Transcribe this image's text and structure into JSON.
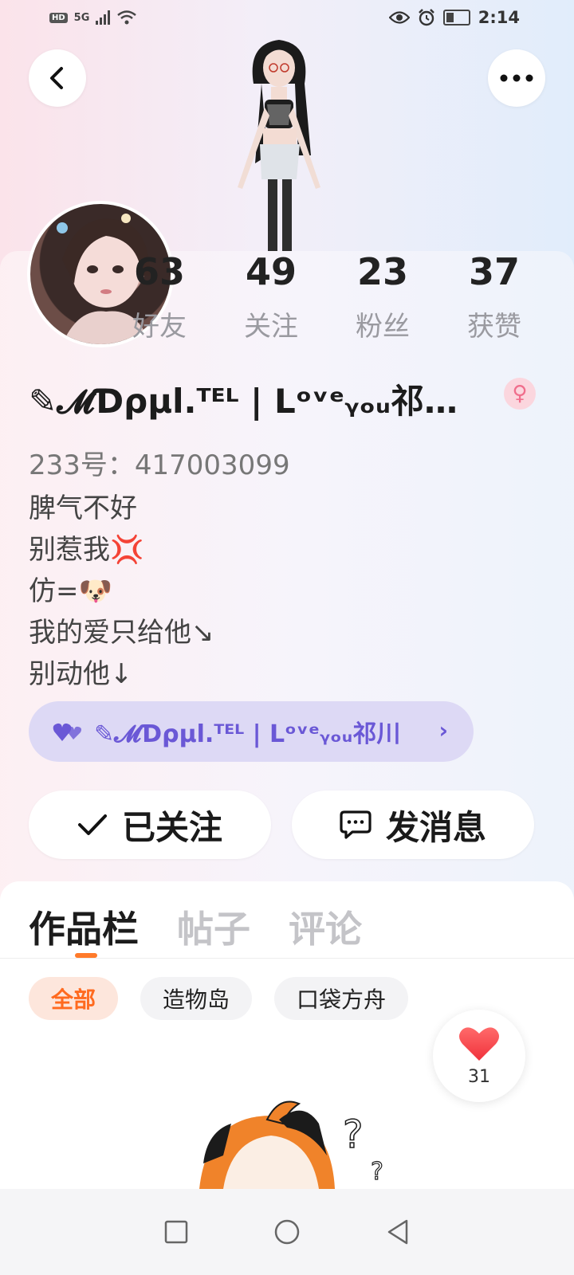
{
  "status_bar": {
    "hd": "HD",
    "network": "5G",
    "time": "2:14"
  },
  "profile": {
    "stats": [
      {
        "value": "63",
        "label": "好友"
      },
      {
        "value": "49",
        "label": "关注"
      },
      {
        "value": "23",
        "label": "粉丝"
      },
      {
        "value": "37",
        "label": "获赞"
      }
    ],
    "nickname": "✎𝓜Ɗρµl.ᵀᴱᴸ | Lᵒᵛᵉᵧₒᵤ祁…",
    "gender_symbol": "♀",
    "uid": "233号：417003099",
    "bio": [
      "脾气不好",
      "别惹我💢",
      "仿=🐶",
      "我的爱只给他↘",
      "别动他↓"
    ],
    "tag": "✎𝓜Ɗρµl.ᵀᴱᴸ | Lᵒᵛᵉᵧₒᵤ祁川"
  },
  "actions": {
    "follow_label": "已关注",
    "message_label": "发消息"
  },
  "tabs": [
    "作品栏",
    "帖子",
    "评论"
  ],
  "chips": [
    "全部",
    "造物岛",
    "口袋方舟"
  ],
  "like_count": "31",
  "colors": {
    "accent": "#ff7a2a",
    "tag_text": "#6a58d6",
    "gender": "#f06e8c"
  }
}
